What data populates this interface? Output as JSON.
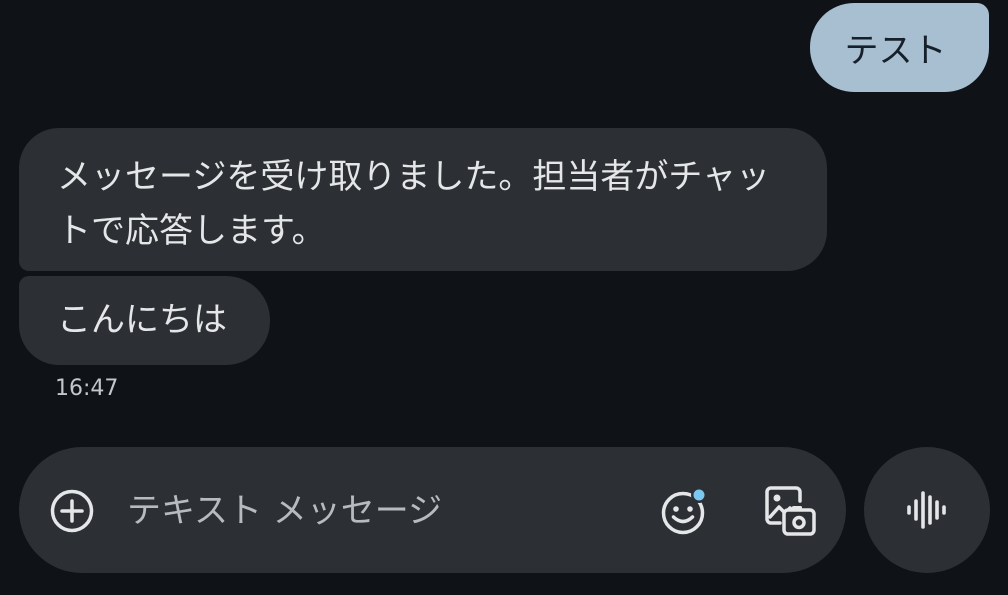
{
  "conversation": {
    "messages": [
      {
        "direction": "sent",
        "text": "テスト"
      },
      {
        "direction": "received",
        "text": "メッセージを受け取りました。担当者がチャットで応答します。"
      },
      {
        "direction": "received",
        "text": "こんにちは"
      }
    ],
    "last_timestamp": "16:47"
  },
  "composer": {
    "placeholder": "テキスト メッセージ",
    "value": "",
    "icons": {
      "add": "add-circle-icon",
      "emoji": "emoji-icon",
      "gallery": "gallery-icon",
      "voice": "voice-waveform-icon"
    }
  },
  "colors": {
    "background": "#0f1318",
    "sent_bubble": "#a8bfd1",
    "received_bubble": "#2c2f33",
    "text_primary": "#e4e6e8",
    "emoji_badge": "#7cc6f2"
  }
}
